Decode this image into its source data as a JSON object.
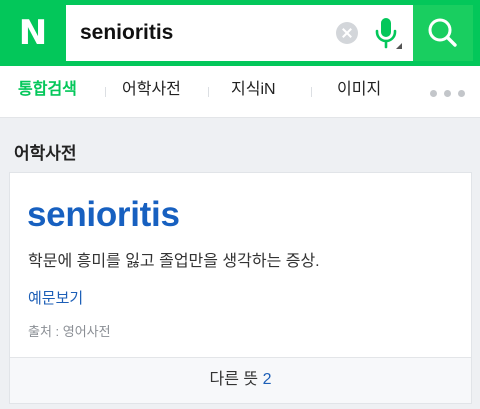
{
  "header": {
    "logo": "N",
    "search_query": "senioritis",
    "colors": {
      "brand": "#03c75a",
      "mic": "#03c75a"
    },
    "icons": [
      "clear-icon",
      "microphone-icon",
      "search-icon"
    ]
  },
  "tabs": [
    {
      "label": "통합검색",
      "active": true
    },
    {
      "label": "어학사전",
      "active": false
    },
    {
      "label": "지식iN",
      "active": false
    },
    {
      "label": "이미지",
      "active": false
    }
  ],
  "section": {
    "title": "어학사전"
  },
  "entry": {
    "word": "senioritis",
    "definition": "학문에 흥미를 잃고 졸업만을 생각하는 증상.",
    "examples_label": "예문보기",
    "source": "출처 : 영어사전",
    "other_meanings_label": "다른 뜻",
    "other_meanings_count": "2"
  }
}
